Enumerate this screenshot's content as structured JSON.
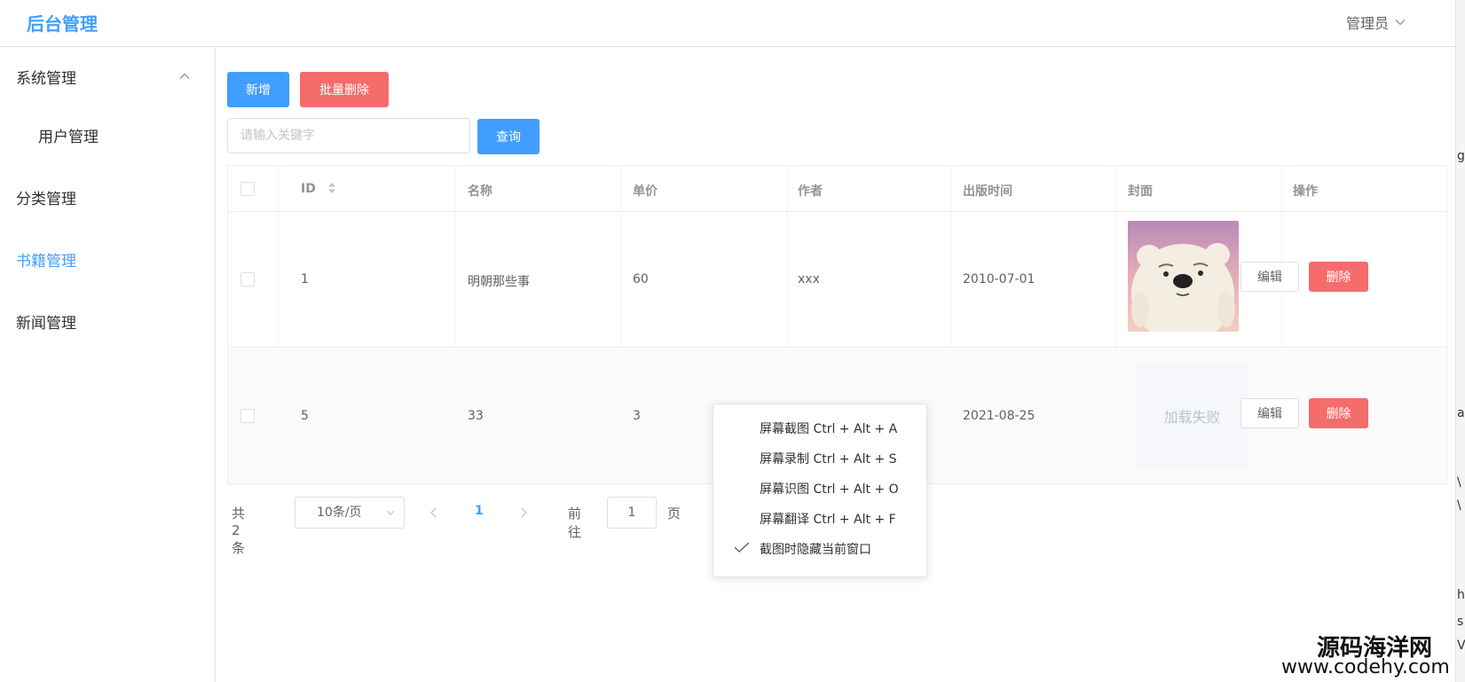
{
  "header": {
    "brand": "后台管理",
    "user": "管理员"
  },
  "sidebar": {
    "items": [
      {
        "label": "系统管理"
      },
      {
        "label": "用户管理"
      },
      {
        "label": "分类管理"
      },
      {
        "label": "书籍管理"
      },
      {
        "label": "新闻管理"
      }
    ],
    "active": "书籍管理"
  },
  "toolbar": {
    "add_label": "新增",
    "batch_delete_label": "批量删除",
    "search_placeholder": "请输入关键字",
    "search_label": "查询"
  },
  "table": {
    "columns": [
      "ID",
      "名称",
      "单价",
      "作者",
      "出版时间",
      "封面",
      "操作"
    ],
    "rows": [
      {
        "id": "1",
        "name": "明朝那些事",
        "price": "60",
        "author": "xxx",
        "date": "2010-07-01",
        "cover_status": "image"
      },
      {
        "id": "5",
        "name": "33",
        "price": "3",
        "author": "",
        "date": "2021-08-25",
        "cover_status": "加载失败"
      }
    ],
    "edit_label": "编辑",
    "delete_label": "删除"
  },
  "pagination": {
    "total": "共 2 条",
    "page_size": "10条/页",
    "current_page": "1",
    "goto_label": "前往",
    "goto_value": "1",
    "page_suffix": "页"
  },
  "context_menu": {
    "items": [
      "屏幕截图 Ctrl + Alt + A",
      "屏幕录制 Ctrl + Alt + S",
      "屏幕识图 Ctrl + Alt + O",
      "屏幕翻译 Ctrl + Alt + F",
      "截图时隐藏当前窗口"
    ],
    "checked_index": 4
  },
  "edge_chars": [
    "g",
    "a",
    "\\",
    "\\",
    "h",
    "s",
    "V"
  ],
  "watermark": {
    "name": "源码海洋网",
    "url": "www.codehy.com"
  },
  "colors": {
    "primary": "#409eff",
    "danger": "#f56c6c",
    "border": "#dcdfe6",
    "text": "#606266"
  }
}
